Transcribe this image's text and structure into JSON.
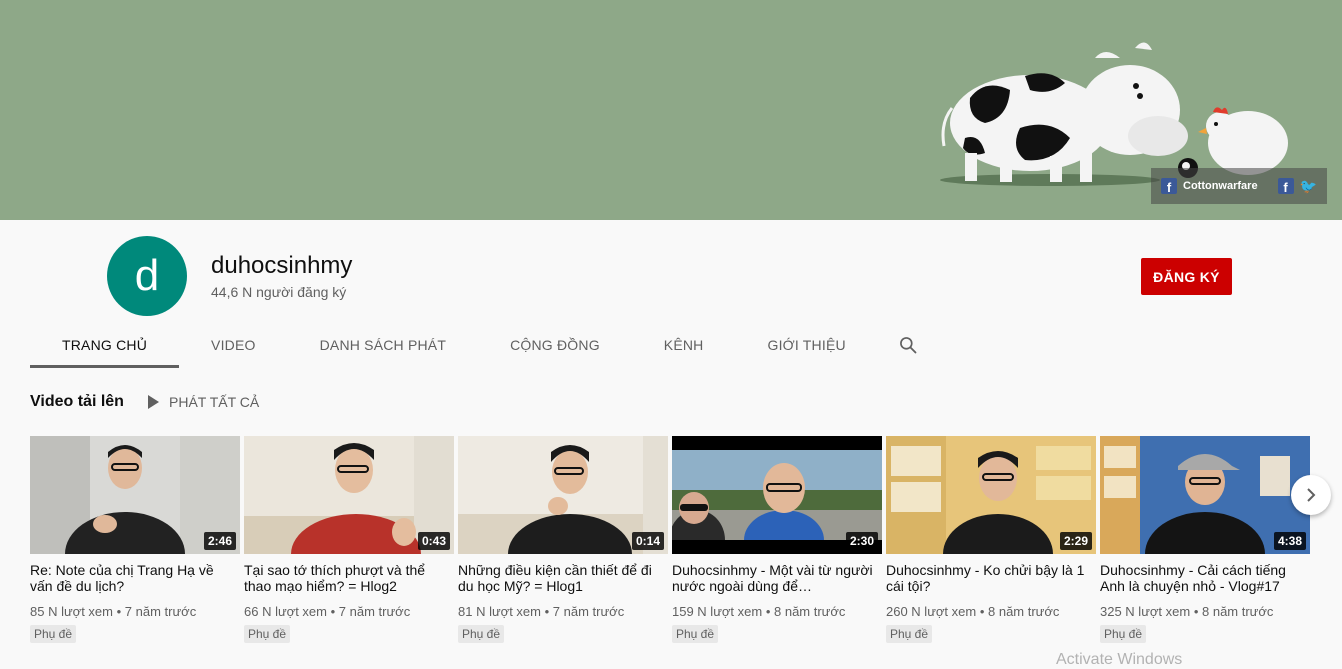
{
  "banner": {
    "social_handle": "Cottonwarfare",
    "icons": [
      "facebook-icon",
      "facebook-icon",
      "twitter-icon"
    ],
    "background_color": "#8ea888"
  },
  "channel": {
    "avatar_letter": "d",
    "avatar_color": "#00897b",
    "name": "duhocsinhmy",
    "subscribers": "44,6 N người đăng ký",
    "subscribe_label": "ĐĂNG KÝ",
    "subscribe_color": "#cc0000"
  },
  "tabs": [
    {
      "label": "TRANG CHỦ",
      "active": true
    },
    {
      "label": "VIDEO",
      "active": false
    },
    {
      "label": "DANH SÁCH PHÁT",
      "active": false
    },
    {
      "label": "CỘNG ĐỒNG",
      "active": false
    },
    {
      "label": "KÊNH",
      "active": false
    },
    {
      "label": "GIỚI THIỆU",
      "active": false
    }
  ],
  "section": {
    "title": "Video tải lên",
    "play_all": "PHÁT TẤT CẢ"
  },
  "videos": [
    {
      "title": "Re: Note của chị Trang Hạ về vấn đề du lịch?",
      "duration": "2:46",
      "views": "85 N lượt xem",
      "age": "7 năm trước",
      "badge": "Phụ đề"
    },
    {
      "title": "Tại sao tớ thích phượt và thể thao mạo hiểm? = Hlog2",
      "duration": "0:43",
      "views": "66 N lượt xem",
      "age": "7 năm trước",
      "badge": "Phụ đề"
    },
    {
      "title": "Những điều kiện cần thiết để đi du học Mỹ? = Hlog1",
      "duration": "0:14",
      "views": "81 N lượt xem",
      "age": "7 năm trước",
      "badge": "Phụ đề"
    },
    {
      "title": "Duhocsinhmy - Một vài từ người nước ngoài dùng để…",
      "duration": "2:30",
      "views": "159 N lượt xem",
      "age": "8 năm trước",
      "badge": "Phụ đề"
    },
    {
      "title": "Duhocsinhmy - Ko chửi bậy là 1 cái tội?",
      "duration": "2:29",
      "views": "260 N lượt xem",
      "age": "8 năm trước",
      "badge": "Phụ đề"
    },
    {
      "title": "Duhocsinhmy - Cải cách tiếng Anh là chuyện nhỏ - Vlog#17",
      "duration": "4:38",
      "views": "325 N lượt xem",
      "age": "8 năm trước",
      "badge": "Phụ đề"
    }
  ],
  "watermark": "Activate Windows"
}
